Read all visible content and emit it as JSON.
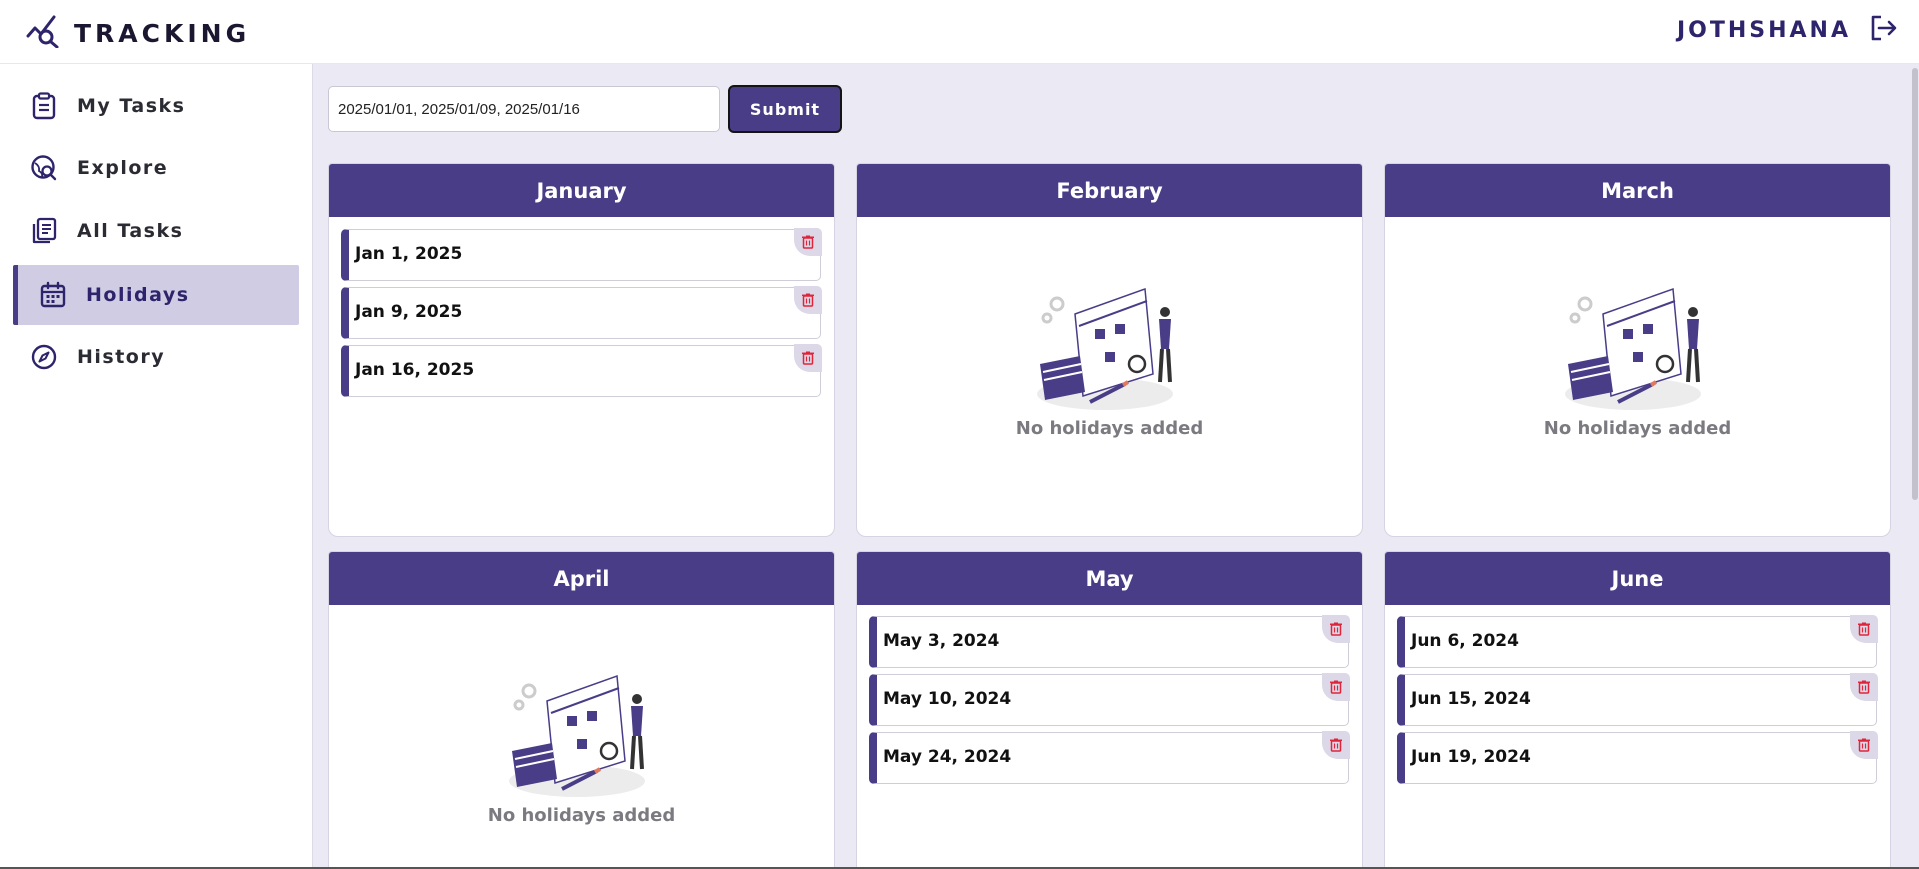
{
  "header": {
    "brand": "TRACKING",
    "user_name": "JOTHSHANA"
  },
  "sidebar": {
    "items": [
      {
        "label": "My Tasks",
        "icon": "clipboard-icon",
        "active": false
      },
      {
        "label": "Explore",
        "icon": "globe-search-icon",
        "active": false
      },
      {
        "label": "All Tasks",
        "icon": "document-stack-icon",
        "active": false
      },
      {
        "label": "Holidays",
        "icon": "calendar-icon",
        "active": true
      },
      {
        "label": "History",
        "icon": "compass-icon",
        "active": false
      }
    ]
  },
  "form": {
    "dates_value": "2025/01/01, 2025/01/09, 2025/01/16",
    "submit_label": "Submit"
  },
  "months": [
    {
      "name": "January",
      "holidays": [
        "Jan 1, 2025",
        "Jan 9, 2025",
        "Jan 16, 2025"
      ]
    },
    {
      "name": "February",
      "holidays": []
    },
    {
      "name": "March",
      "holidays": []
    },
    {
      "name": "April",
      "holidays": []
    },
    {
      "name": "May",
      "holidays": [
        "May 3, 2024",
        "May 10, 2024",
        "May 24, 2024"
      ]
    },
    {
      "name": "June",
      "holidays": [
        "Jun 6, 2024",
        "Jun 15, 2024",
        "Jun 19, 2024"
      ]
    }
  ],
  "empty_text": "No holidays added",
  "colors": {
    "accent": "#4a3d87",
    "active_bg": "#cfcce3",
    "main_bg": "#ebe9f3",
    "delete": "#e0243a"
  }
}
